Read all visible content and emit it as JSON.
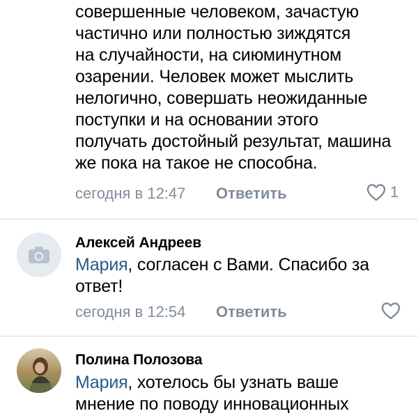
{
  "comments": [
    {
      "lines": [
        "совершенные человеком, зачастую",
        "частично или полностью зиждятся",
        "на случайности, на сиюминутном",
        "озарении. Человек может мыслить",
        "нелогично, совершать неожиданные",
        "поступки и на основании этого",
        "получать достойный результат, машина",
        "же пока на такое не способна."
      ],
      "time": "сегодня в 12:47",
      "reply_label": "Ответить",
      "likes": "1"
    },
    {
      "author": "Алексей Андреев",
      "mention": "Мария",
      "lines": [
        ", согласен с Вами. Спасибо за",
        "ответ!"
      ],
      "time": "сегодня в 12:54",
      "reply_label": "Ответить"
    },
    {
      "author": "Полина Полозова",
      "mention": "Мария",
      "lines": [
        ", хотелось бы узнать ваше",
        "мнение по поводу инновационных"
      ]
    }
  ],
  "colors": {
    "text": "#000000",
    "mention": "#2a5885",
    "meta": "#818c99",
    "divider": "#d7d8db",
    "avatar_placeholder": "#e6ebf0"
  },
  "icons": [
    "heart-icon",
    "camera-icon"
  ]
}
